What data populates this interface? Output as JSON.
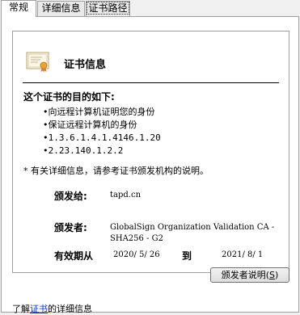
{
  "tabs": [
    {
      "label": "常规",
      "active": true
    },
    {
      "label": "详细信息",
      "active": false
    },
    {
      "label": "证书路径",
      "active": false
    }
  ],
  "cert_info": {
    "title": "证书信息",
    "icon": "certificate-icon",
    "purpose_heading": "这个证书的目的如下:",
    "purposes": [
      "•向远程计算机证明您的身份",
      "•保证远程计算机的身份",
      "•1.3.6.1.4.1.4146.1.20",
      "•2.23.140.1.2.2"
    ],
    "note": "* 有关详细信息，请参考证书颁发机构的说明。",
    "issued_to_label": "颁发给:",
    "issued_to": "tapd.cn",
    "issued_by_label": "颁发者:",
    "issued_by": "GlobalSign Organization Validation CA - SHA256 - G2",
    "valid_label": "有效期从",
    "valid_from": "2020/ 5/ 26",
    "to_label": "到",
    "valid_until": "2021/ 8/ 1"
  },
  "issuer_statement_button": {
    "label": "颁发者说明",
    "accel": "S"
  },
  "footer": {
    "prefix": "了解",
    "link": "证书",
    "suffix": "的详细信息"
  }
}
